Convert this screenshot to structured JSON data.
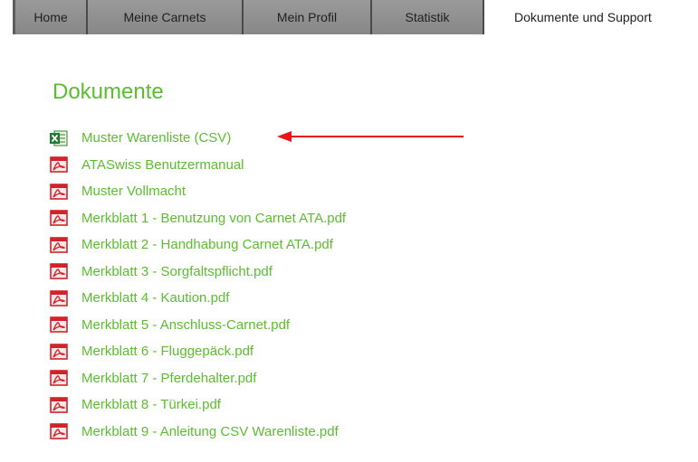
{
  "nav": {
    "tabs": [
      {
        "label": "Home"
      },
      {
        "label": "Meine Carnets"
      },
      {
        "label": "Mein Profil"
      },
      {
        "label": "Statistik"
      }
    ],
    "active_tab": "Dokumente und Support"
  },
  "main": {
    "heading": "Dokumente",
    "documents": [
      {
        "label": "Muster Warenliste (CSV)",
        "icon": "excel-icon"
      },
      {
        "label": "ATASwiss Benutzermanual",
        "icon": "pdf-icon"
      },
      {
        "label": "Muster Vollmacht",
        "icon": "pdf-icon"
      },
      {
        "label": "Merkblatt 1 - Benutzung von Carnet ATA.pdf",
        "icon": "pdf-icon"
      },
      {
        "label": "Merkblatt 2 - Handhabung Carnet ATA.pdf",
        "icon": "pdf-icon"
      },
      {
        "label": "Merkblatt 3 - Sorgfaltspflicht.pdf",
        "icon": "pdf-icon"
      },
      {
        "label": "Merkblatt 4 - Kaution.pdf",
        "icon": "pdf-icon"
      },
      {
        "label": "Merkblatt 5 - Anschluss-Carnet.pdf",
        "icon": "pdf-icon"
      },
      {
        "label": "Merkblatt 6 - Fluggepäck.pdf",
        "icon": "pdf-icon"
      },
      {
        "label": "Merkblatt 7 - Pferdehalter.pdf",
        "icon": "pdf-icon"
      },
      {
        "label": "Merkblatt 8 - Türkei.pdf",
        "icon": "pdf-icon"
      },
      {
        "label": "Merkblatt 9 - Anleitung CSV Warenliste.pdf",
        "icon": "pdf-icon"
      }
    ]
  },
  "colors": {
    "link": "#5bbd2f",
    "nav_bg": "#8e8e8e",
    "arrow": "#e8141b"
  }
}
